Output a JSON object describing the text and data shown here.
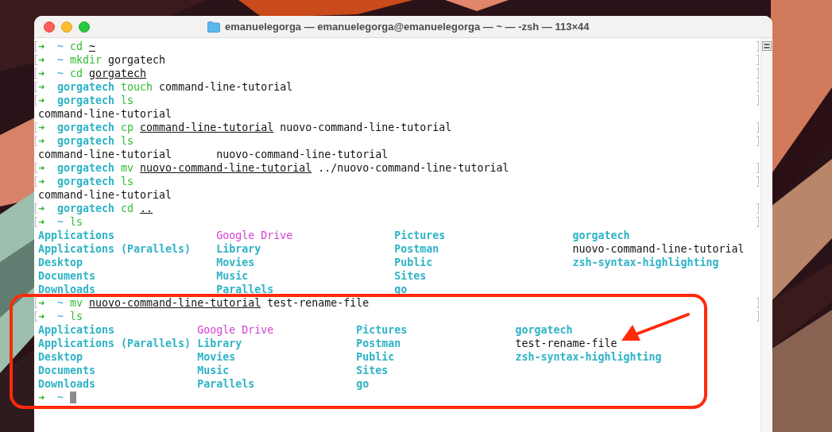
{
  "window": {
    "title": "emanuelegorga — emanuelegorga@emanuelegorga — ~ — -zsh — 113×44"
  },
  "terminal": {
    "lines": [
      {
        "kind": "prompt",
        "marked": true,
        "symbol": "➜",
        "directory": "~",
        "command": "cd",
        "args": [
          {
            "text": "~",
            "underlined": true
          }
        ]
      },
      {
        "kind": "prompt",
        "marked": true,
        "symbol": "➜",
        "directory": "~",
        "command": "mkdir",
        "args": [
          {
            "text": "gorgatech",
            "underlined": false
          }
        ]
      },
      {
        "kind": "prompt",
        "marked": true,
        "symbol": "➜",
        "directory": "~",
        "command": "cd",
        "args": [
          {
            "text": "gorgatech",
            "underlined": true
          }
        ]
      },
      {
        "kind": "prompt",
        "marked": true,
        "symbol": "➜",
        "directory": "gorgatech",
        "command": "touch",
        "args": [
          {
            "text": "command-line-tutorial",
            "underlined": false
          }
        ]
      },
      {
        "kind": "prompt",
        "marked": true,
        "symbol": "➜",
        "directory": "gorgatech",
        "command": "ls"
      },
      {
        "kind": "listing",
        "rows": [
          [
            {
              "name": "command-line-tutorial",
              "kind": "file"
            }
          ]
        ]
      },
      {
        "kind": "prompt",
        "marked": true,
        "symbol": "➜",
        "directory": "gorgatech",
        "command": "cp",
        "args": [
          {
            "text": "command-line-tutorial",
            "underlined": true
          },
          {
            "text": "nuovo-command-line-tutorial",
            "underlined": false
          }
        ]
      },
      {
        "kind": "prompt",
        "marked": true,
        "symbol": "➜",
        "directory": "gorgatech",
        "command": "ls"
      },
      {
        "kind": "listing",
        "rows": [
          [
            {
              "name": "command-line-tutorial",
              "kind": "file"
            },
            {
              "name": "nuovo-command-line-tutorial",
              "kind": "file"
            }
          ]
        ]
      },
      {
        "kind": "prompt",
        "marked": true,
        "symbol": "➜",
        "directory": "gorgatech",
        "command": "mv",
        "args": [
          {
            "text": "nuovo-command-line-tutorial",
            "underlined": true
          },
          {
            "text": "../nuovo-command-line-tutorial",
            "underlined": false
          }
        ]
      },
      {
        "kind": "prompt",
        "marked": true,
        "symbol": "➜",
        "directory": "gorgatech",
        "command": "ls"
      },
      {
        "kind": "listing",
        "rows": [
          [
            {
              "name": "command-line-tutorial",
              "kind": "file"
            }
          ]
        ]
      },
      {
        "kind": "prompt",
        "marked": true,
        "symbol": "➜",
        "directory": "gorgatech",
        "command": "cd",
        "args": [
          {
            "text": "..",
            "underlined": true
          }
        ]
      },
      {
        "kind": "prompt",
        "marked": true,
        "symbol": "➜",
        "directory": "~",
        "command": "ls"
      },
      {
        "kind": "listing",
        "rows": [
          [
            {
              "name": "Applications",
              "kind": "dir"
            },
            {
              "name": "Google Drive",
              "kind": "link"
            },
            {
              "name": "Pictures",
              "kind": "dir"
            },
            {
              "name": "gorgatech",
              "kind": "dir"
            }
          ],
          [
            {
              "name": "Applications (Parallels)",
              "kind": "dir"
            },
            {
              "name": "Library",
              "kind": "dir"
            },
            {
              "name": "Postman",
              "kind": "dir"
            },
            {
              "name": "nuovo-command-line-tutorial",
              "kind": "file"
            }
          ],
          [
            {
              "name": "Desktop",
              "kind": "dir"
            },
            {
              "name": "Movies",
              "kind": "dir"
            },
            {
              "name": "Public",
              "kind": "dir"
            },
            {
              "name": "zsh-syntax-highlighting",
              "kind": "dir"
            }
          ],
          [
            {
              "name": "Documents",
              "kind": "dir"
            },
            {
              "name": "Music",
              "kind": "dir"
            },
            {
              "name": "Sites",
              "kind": "dir"
            }
          ],
          [
            {
              "name": "Downloads",
              "kind": "dir"
            },
            {
              "name": "Parallels",
              "kind": "dir"
            },
            {
              "name": "go",
              "kind": "dir"
            }
          ]
        ]
      },
      {
        "kind": "prompt",
        "marked": true,
        "symbol": "➜",
        "directory": "~",
        "command": "mv",
        "args": [
          {
            "text": "nuovo-command-line-tutorial",
            "underlined": true
          },
          {
            "text": "test-rename-file",
            "underlined": false
          }
        ]
      },
      {
        "kind": "prompt",
        "marked": true,
        "symbol": "➜",
        "directory": "~",
        "command": "ls"
      },
      {
        "kind": "listing",
        "rows": [
          [
            {
              "name": "Applications",
              "kind": "dir"
            },
            {
              "name": "Google Drive",
              "kind": "link"
            },
            {
              "name": "Pictures",
              "kind": "dir"
            },
            {
              "name": "gorgatech",
              "kind": "dir"
            }
          ],
          [
            {
              "name": "Applications (Parallels)",
              "kind": "dir"
            },
            {
              "name": "Library",
              "kind": "dir"
            },
            {
              "name": "Postman",
              "kind": "dir"
            },
            {
              "name": "test-rename-file",
              "kind": "file"
            }
          ],
          [
            {
              "name": "Desktop",
              "kind": "dir"
            },
            {
              "name": "Movies",
              "kind": "dir"
            },
            {
              "name": "Public",
              "kind": "dir"
            },
            {
              "name": "zsh-syntax-highlighting",
              "kind": "dir"
            }
          ],
          [
            {
              "name": "Documents",
              "kind": "dir"
            },
            {
              "name": "Music",
              "kind": "dir"
            },
            {
              "name": "Sites",
              "kind": "dir"
            }
          ],
          [
            {
              "name": "Downloads",
              "kind": "dir"
            },
            {
              "name": "Parallels",
              "kind": "dir"
            },
            {
              "name": "go",
              "kind": "dir"
            }
          ]
        ]
      },
      {
        "kind": "prompt",
        "marked": false,
        "symbol": "➜",
        "directory": "~",
        "cursor": true
      }
    ]
  }
}
